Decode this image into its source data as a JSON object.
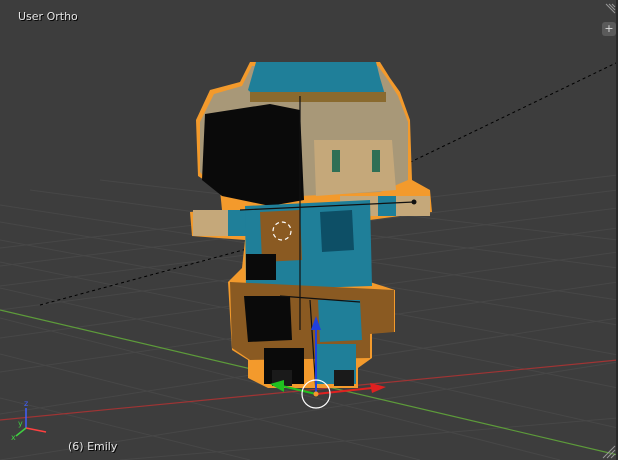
{
  "viewport": {
    "view_name": "User Ortho",
    "active_object": "(6) Emily"
  },
  "widgets": {
    "add_button": "+"
  },
  "colors": {
    "background": "#3d3d3d",
    "grid": "#4a4a4a",
    "x_axis": "#b53b3b",
    "y_axis": "#5d9b3a",
    "selection_outline": "#f39a2c",
    "gizmo_x": "#e02020",
    "gizmo_y": "#20c020",
    "gizmo_z": "#2040e0"
  },
  "icons": [
    "corner-split-icon",
    "plus-icon",
    "axis-gizmo-icon",
    "manipulator-icon",
    "3d-cursor-icon"
  ]
}
